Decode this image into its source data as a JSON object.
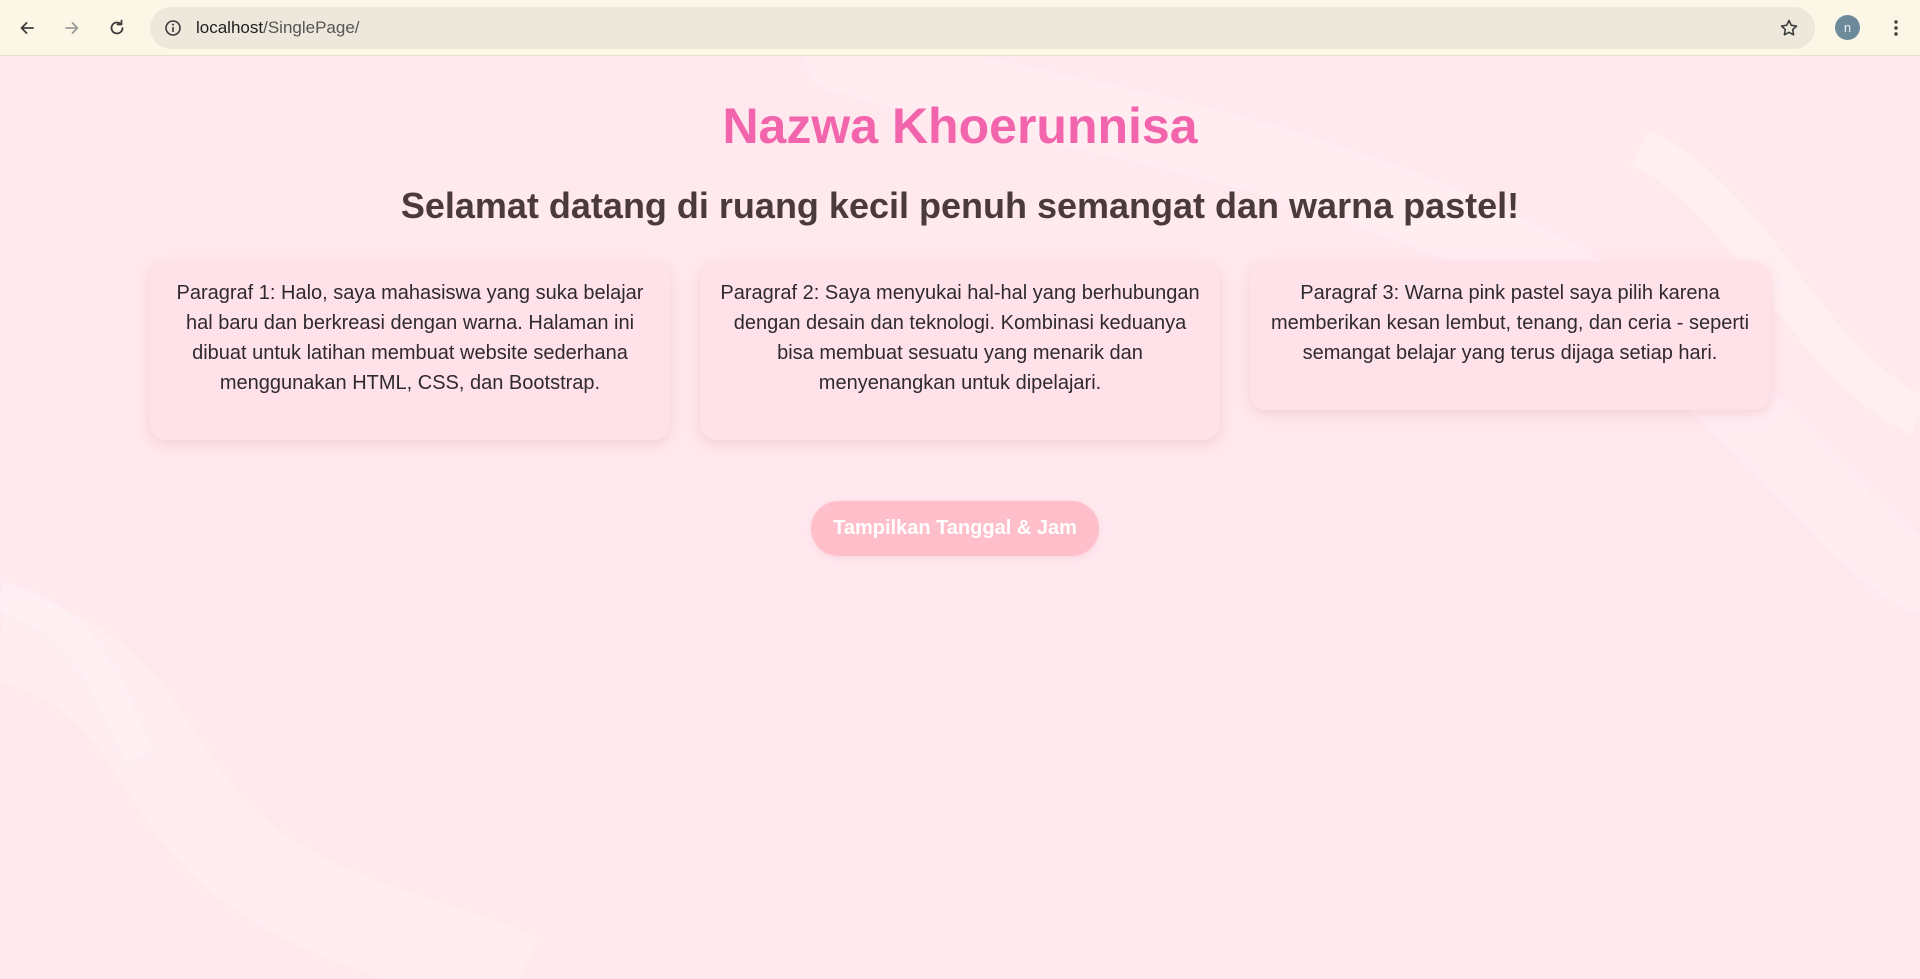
{
  "browser": {
    "url_host": "localhost",
    "url_path": "/SinglePage/",
    "profile_initial": "n"
  },
  "page": {
    "title": "Nazwa Khoerunnisa",
    "subtitle": "Selamat datang di ruang kecil penuh semangat dan warna pastel!",
    "paragraphs": [
      "Paragraf 1: Halo, saya mahasiswa yang suka belajar hal baru dan berkreasi dengan warna. Halaman ini dibuat untuk latihan membuat website sederhana menggunakan HTML, CSS, dan Bootstrap.",
      "Paragraf 2: Saya menyukai hal-hal yang berhubungan dengan desain dan teknologi. Kombinasi keduanya bisa membuat sesuatu yang menarik dan menyenangkan untuk dipelajari.",
      "Paragraf 3: Warna pink pastel saya pilih karena memberikan kesan lembut, tenang, dan ceria - seperti semangat belajar yang terus dijaga setiap hari."
    ],
    "button_label": "Tampilkan Tanggal & Jam"
  },
  "colors": {
    "title": "#f265ad",
    "background": "#ffe8ee",
    "card": "#ffe1e9",
    "button": "#ffbfca",
    "browser_bar": "#fcf6e6"
  },
  "icons": {
    "back": "arrow-left-icon",
    "forward": "arrow-right-icon",
    "reload": "reload-icon",
    "site_info": "info-icon",
    "bookmark": "star-icon",
    "menu": "kebab-menu-icon"
  }
}
